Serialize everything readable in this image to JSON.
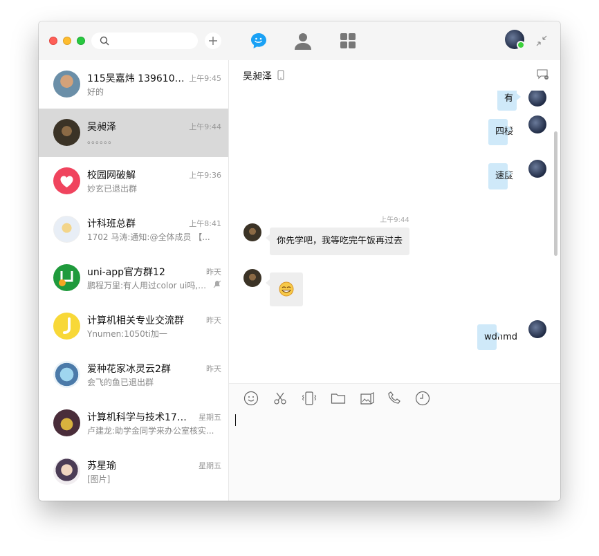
{
  "search": {
    "placeholder": ""
  },
  "nav": {
    "chat_icon": "chat-bubble-icon",
    "contacts_icon": "person-icon",
    "apps_icon": "grid-icon"
  },
  "colors": {
    "accent": "#1aa1f5",
    "selected_row": "#d9d9d9",
    "my_bubble": "#cfe9f9",
    "other_bubble": "#eeeeee",
    "online": "#3bd13b"
  },
  "conversations": [
    {
      "name": "115吴嘉炜 13961081...",
      "time": "上午9:45",
      "preview": "好的"
    },
    {
      "name": "吴昶泽",
      "time": "上午9:44",
      "preview": "。。。。。。"
    },
    {
      "name": "校园网破解",
      "time": "上午9:36",
      "preview": "妙玄已退出群"
    },
    {
      "name": "计科班总群",
      "time": "上午8:41",
      "preview": "1702 马涛:通知:@全体成员  【..."
    },
    {
      "name": "uni-app官方群12",
      "time": "昨天",
      "preview": "鹏程万里:有人用过color ui吗, 那..."
    },
    {
      "name": "计算机相关专业交流群",
      "time": "昨天",
      "preview": "Ynumen:1050ti加一"
    },
    {
      "name": "爱种花家冰灵云2群",
      "time": "昨天",
      "preview": "会飞的鱼已退出群"
    },
    {
      "name": "计算机科学与技术1702",
      "time": "星期五",
      "preview": "卢建龙:助学金同学来办公室核实..."
    },
    {
      "name": "苏星瑜",
      "time": "星期五",
      "preview": "[图片]"
    }
  ],
  "chat": {
    "title": "吴昶泽",
    "timestamp": "上午9:44",
    "messages": [
      {
        "from": "me",
        "text": "有"
      },
      {
        "from": "me",
        "text": "四楼"
      },
      {
        "from": "me",
        "text": "速度"
      },
      {
        "from": "other",
        "text": "你先学吧，我等吃完午饭再过去"
      },
      {
        "from": "other",
        "text": "",
        "emoji": "grin-emoji"
      },
      {
        "from": "me",
        "text": "wdnmd"
      }
    ]
  },
  "toolbar": {
    "tools": [
      "smile-icon",
      "scissors-icon",
      "vibrate-icon",
      "folder-icon",
      "image-icon",
      "phone-icon",
      "clock-icon"
    ]
  }
}
